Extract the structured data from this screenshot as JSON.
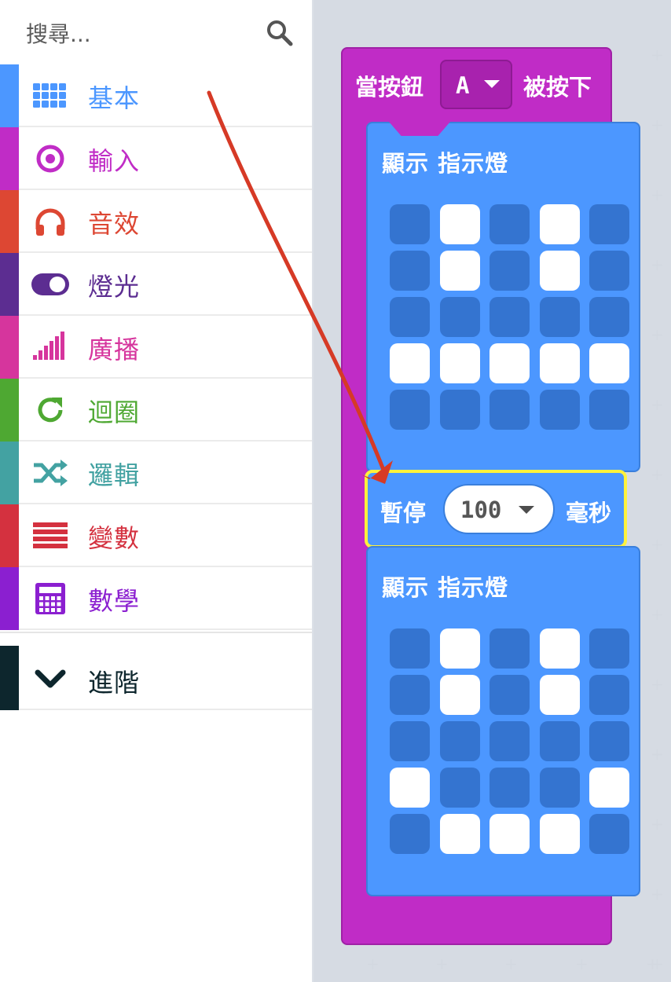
{
  "search": {
    "placeholder": "搜尋..."
  },
  "categories": [
    {
      "label": "基本",
      "color": "#4c97ff",
      "icon": "grid-icon"
    },
    {
      "label": "輸入",
      "color": "#c02cc6",
      "icon": "target-icon"
    },
    {
      "label": "音效",
      "color": "#dd4733",
      "icon": "headphones-icon"
    },
    {
      "label": "燈光",
      "color": "#5c2d91",
      "icon": "toggle-icon"
    },
    {
      "label": "廣播",
      "color": "#d6359d",
      "icon": "signal-icon"
    },
    {
      "label": "迴圈",
      "color": "#4ea832",
      "icon": "refresh-icon"
    },
    {
      "label": "邏輯",
      "color": "#43a2a2",
      "icon": "shuffle-icon"
    },
    {
      "label": "變數",
      "color": "#d4313f",
      "icon": "list-icon"
    },
    {
      "label": "數學",
      "color": "#8b1fd0",
      "icon": "calculator-icon"
    }
  ],
  "advanced": {
    "label": "進階",
    "color": "#0d262d",
    "icon": "chevron-down-icon"
  },
  "event_block": {
    "prefix": "當按鈕",
    "button": "A",
    "suffix": "被按下",
    "color": "#c02cc6"
  },
  "show_blocks": [
    {
      "title": "顯示  指示燈",
      "leds": [
        [
          0,
          1,
          0,
          1,
          0
        ],
        [
          0,
          1,
          0,
          1,
          0
        ],
        [
          0,
          0,
          0,
          0,
          0
        ],
        [
          1,
          1,
          1,
          1,
          1
        ],
        [
          0,
          0,
          0,
          0,
          0
        ]
      ]
    },
    {
      "title": "顯示  指示燈",
      "leds": [
        [
          0,
          1,
          0,
          1,
          0
        ],
        [
          0,
          1,
          0,
          1,
          0
        ],
        [
          0,
          0,
          0,
          0,
          0
        ],
        [
          1,
          0,
          0,
          0,
          1
        ],
        [
          0,
          1,
          1,
          1,
          0
        ]
      ]
    }
  ],
  "pause_block": {
    "label": "暫停",
    "value": "100",
    "unit": "毫秒"
  },
  "annotation_arrow_color": "#d63a26"
}
